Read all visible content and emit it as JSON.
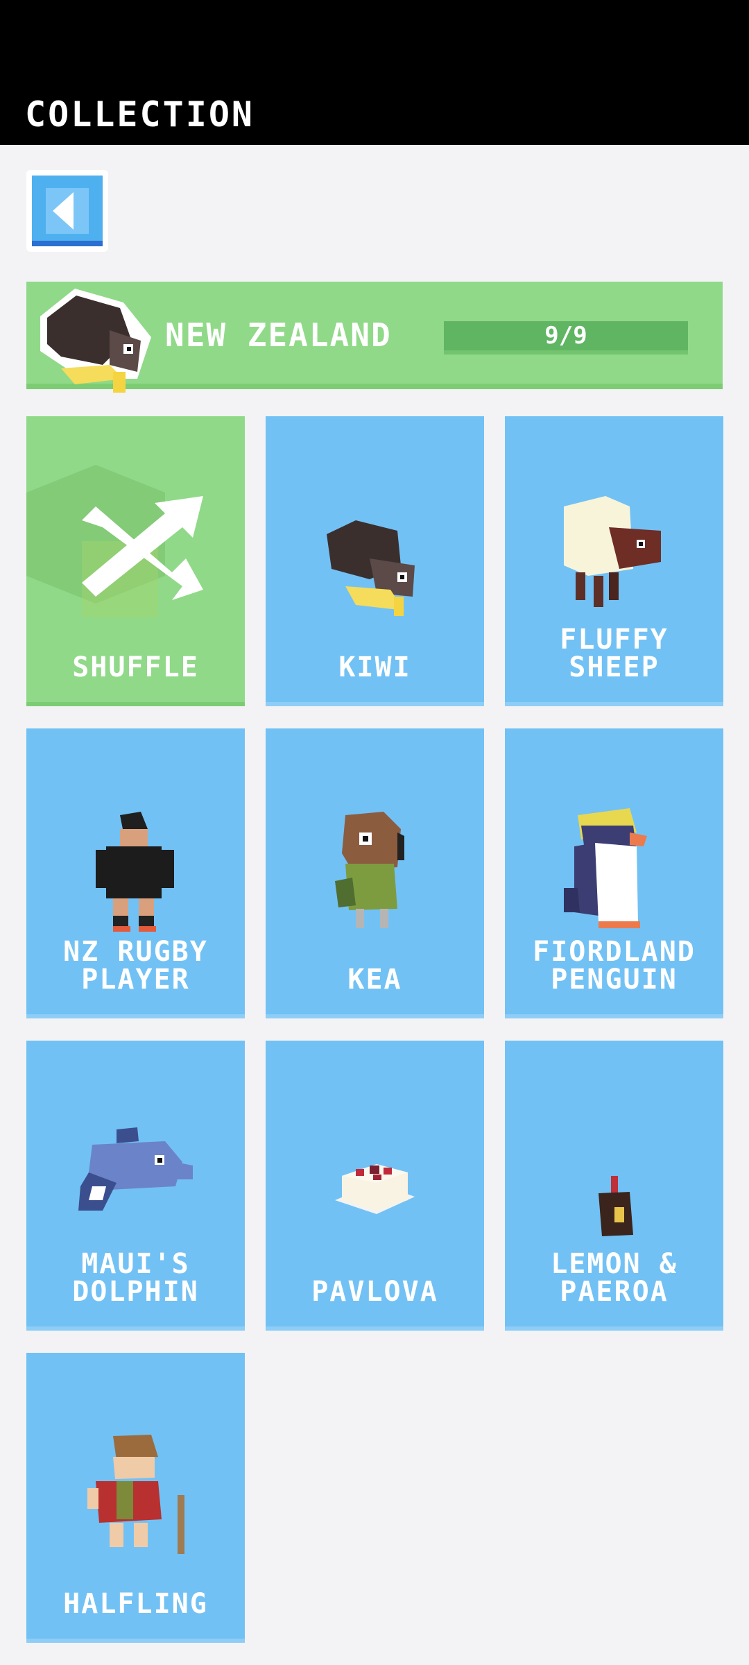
{
  "header": {
    "title": "COLLECTION"
  },
  "back_button": {
    "icon": "back-arrow-icon"
  },
  "region": {
    "name": "NEW ZEALAND",
    "progress_text": "9/9",
    "progress_fraction": 1.0
  },
  "characters": [
    {
      "label": "SHUFFLE"
    },
    {
      "label": "KIWI"
    },
    {
      "label": "FLUFFY\nSHEEP"
    },
    {
      "label": "NZ RUGBY\nPLAYER"
    },
    {
      "label": "KEA"
    },
    {
      "label": "FIORDLAND\nPENGUIN"
    },
    {
      "label": "MAUI'S\nDOLPHIN"
    },
    {
      "label": "PAVLOVA"
    },
    {
      "label": "LEMON &\nPAEROA"
    },
    {
      "label": "HALFLING"
    }
  ],
  "colors": {
    "header_bg": "#000000",
    "page_bg": "#f3f3f5",
    "card_blue": "#72c1f4",
    "card_green": "#90d988",
    "progress_fill": "#5fb562"
  }
}
